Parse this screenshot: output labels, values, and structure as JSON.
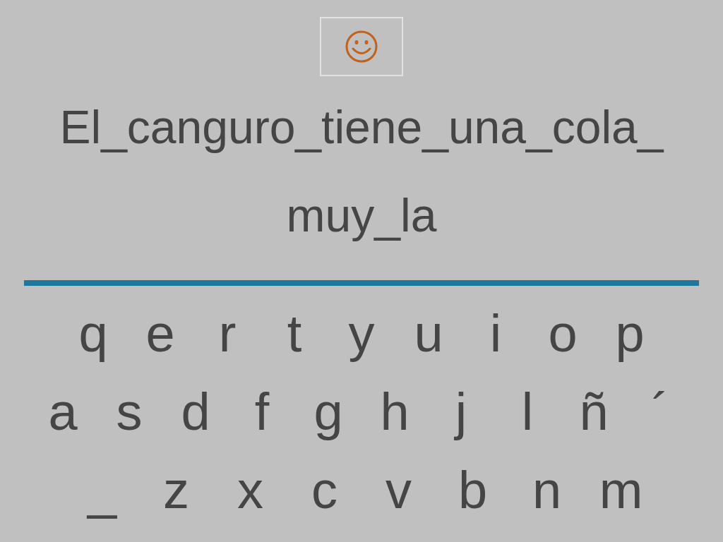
{
  "sentence_lines": [
    "El_canguro_tiene_una_cola_",
    "muy_la"
  ],
  "keyboard": {
    "rows": [
      [
        "q",
        "e",
        "r",
        "t",
        "y",
        "u",
        "i",
        "o",
        "p"
      ],
      [
        "a",
        "s",
        "d",
        "f",
        "g",
        "h",
        "j",
        "l",
        "ñ",
        "´"
      ],
      [
        "_",
        "z",
        "x",
        "c",
        "v",
        "b",
        "n",
        "m"
      ]
    ]
  }
}
